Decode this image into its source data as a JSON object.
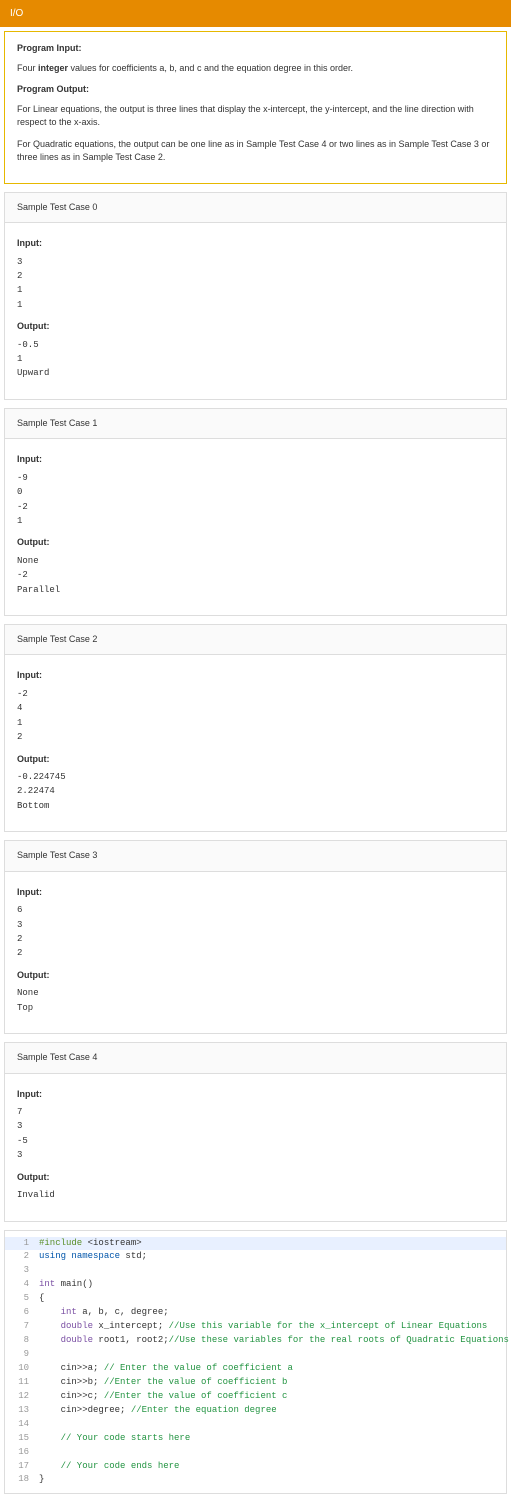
{
  "header": {
    "title": "I/O"
  },
  "desc": {
    "h1": "Program Input:",
    "p1_pre": "Four ",
    "p1_bold": "integer",
    "p1_post": " values for coefficients a, b, and c and the equation degree in this order.",
    "h2": "Program Output:",
    "p2": "For Linear equations, the output is three lines that display the x-intercept, the y-intercept, and the line direction with respect to the x-axis.",
    "p3": "For Quadratic equations, the output can be one line as in Sample Test Case 4 or two lines as in Sample Test Case 3 or three lines as in Sample Test Case 2."
  },
  "samples": [
    {
      "title": "Sample Test Case 0",
      "input": "3\n2\n1\n1",
      "output": "-0.5\n1\nUpward"
    },
    {
      "title": "Sample Test Case 1",
      "input": "-9\n0\n-2\n1",
      "output": "None\n-2\nParallel"
    },
    {
      "title": "Sample Test Case 2",
      "input": "-2\n4\n1\n2",
      "output": "-0.224745\n2.22474\nBottom"
    },
    {
      "title": "Sample Test Case 3",
      "input": "6\n3\n2\n2",
      "output": "None\nTop"
    },
    {
      "title": "Sample Test Case 4",
      "input": "7\n3\n-5\n3",
      "output": "Invalid"
    }
  ],
  "labels": {
    "input": "Input:",
    "output": "Output:"
  },
  "code": {
    "lines": [
      {
        "n": 1,
        "hl": true,
        "seg": [
          {
            "c": "c-pre",
            "t": "#include"
          },
          {
            "c": "",
            "t": " <iostream>"
          }
        ]
      },
      {
        "n": 2,
        "hl": false,
        "seg": [
          {
            "c": "c-kw",
            "t": "using"
          },
          {
            "c": "",
            "t": " "
          },
          {
            "c": "c-kw",
            "t": "namespace"
          },
          {
            "c": "",
            "t": " std;"
          }
        ]
      },
      {
        "n": 3,
        "hl": false,
        "seg": [
          {
            "c": "",
            "t": ""
          }
        ]
      },
      {
        "n": 4,
        "hl": false,
        "seg": [
          {
            "c": "c-type",
            "t": "int"
          },
          {
            "c": "",
            "t": " main()"
          }
        ]
      },
      {
        "n": 5,
        "hl": false,
        "seg": [
          {
            "c": "",
            "t": "{"
          }
        ]
      },
      {
        "n": 6,
        "hl": false,
        "seg": [
          {
            "c": "",
            "t": "    "
          },
          {
            "c": "c-type",
            "t": "int"
          },
          {
            "c": "",
            "t": " a, b, c, degree;"
          }
        ]
      },
      {
        "n": 7,
        "hl": false,
        "seg": [
          {
            "c": "",
            "t": "    "
          },
          {
            "c": "c-type",
            "t": "double"
          },
          {
            "c": "",
            "t": " x_intercept; "
          },
          {
            "c": "c-cmt",
            "t": "//Use this variable for the x_intercept of Linear Equations"
          }
        ]
      },
      {
        "n": 8,
        "hl": false,
        "seg": [
          {
            "c": "",
            "t": "    "
          },
          {
            "c": "c-type",
            "t": "double"
          },
          {
            "c": "",
            "t": " root1, root2;"
          },
          {
            "c": "c-cmt",
            "t": "//Use these variables for the real roots of Quadratic Equations"
          }
        ]
      },
      {
        "n": 9,
        "hl": false,
        "seg": [
          {
            "c": "",
            "t": ""
          }
        ]
      },
      {
        "n": 10,
        "hl": false,
        "seg": [
          {
            "c": "",
            "t": "    cin>>a; "
          },
          {
            "c": "c-cmt",
            "t": "// Enter the value of coefficient a"
          }
        ]
      },
      {
        "n": 11,
        "hl": false,
        "seg": [
          {
            "c": "",
            "t": "    cin>>b; "
          },
          {
            "c": "c-cmt",
            "t": "//Enter the value of coefficient b"
          }
        ]
      },
      {
        "n": 12,
        "hl": false,
        "seg": [
          {
            "c": "",
            "t": "    cin>>c; "
          },
          {
            "c": "c-cmt",
            "t": "//Enter the value of coefficient c"
          }
        ]
      },
      {
        "n": 13,
        "hl": false,
        "seg": [
          {
            "c": "",
            "t": "    cin>>degree; "
          },
          {
            "c": "c-cmt",
            "t": "//Enter the equation degree"
          }
        ]
      },
      {
        "n": 14,
        "hl": false,
        "seg": [
          {
            "c": "",
            "t": ""
          }
        ]
      },
      {
        "n": 15,
        "hl": false,
        "seg": [
          {
            "c": "",
            "t": "    "
          },
          {
            "c": "c-cmt",
            "t": "// Your code starts here"
          }
        ]
      },
      {
        "n": 16,
        "hl": false,
        "seg": [
          {
            "c": "",
            "t": ""
          }
        ]
      },
      {
        "n": 17,
        "hl": false,
        "seg": [
          {
            "c": "",
            "t": "    "
          },
          {
            "c": "c-cmt",
            "t": "// Your code ends here"
          }
        ]
      },
      {
        "n": 18,
        "hl": false,
        "seg": [
          {
            "c": "",
            "t": "}"
          }
        ]
      }
    ]
  }
}
